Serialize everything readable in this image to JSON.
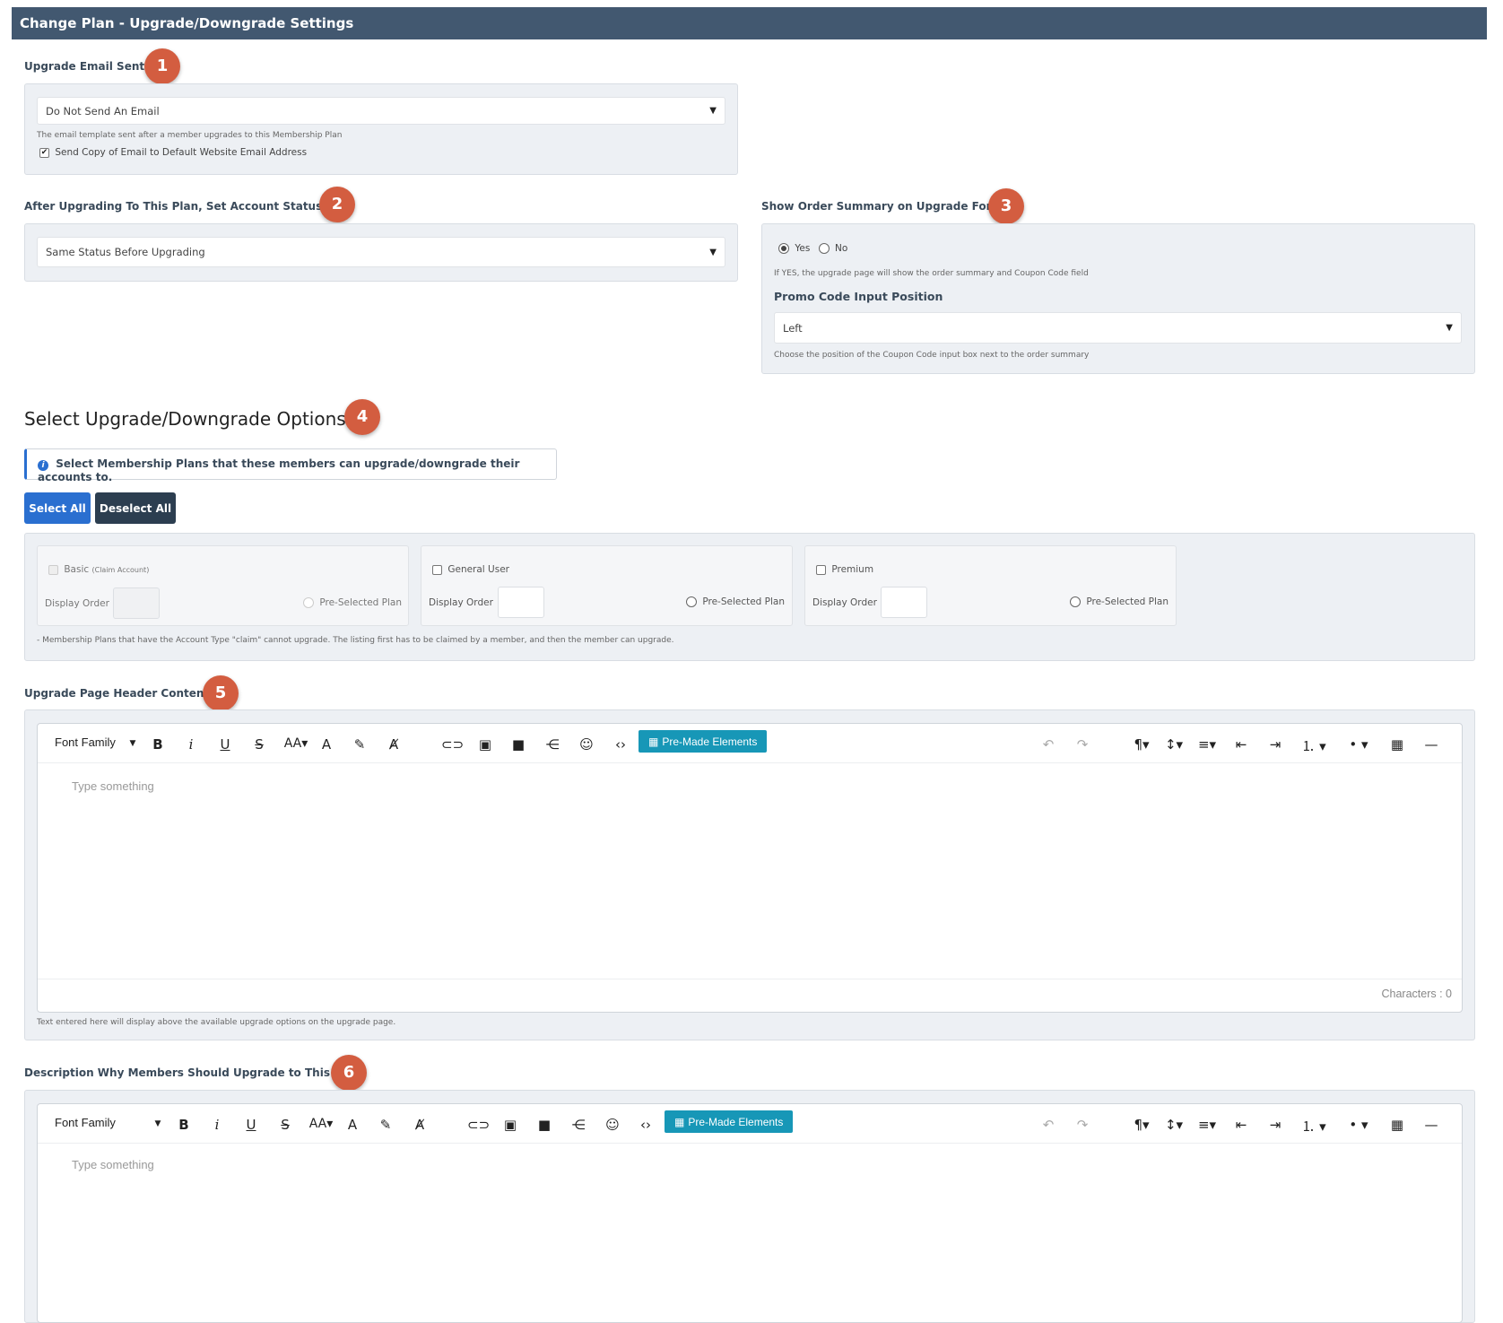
{
  "header": {
    "title": "Change Plan - Upgrade/Downgrade Settings"
  },
  "upgrade_email": {
    "label": "Upgrade Email Sent",
    "badge": "1",
    "selected": "Do Not Send An Email",
    "help": "The email template sent after a member upgrades to this Membership Plan",
    "copy_label": "Send Copy of Email to Default Website Email Address",
    "copy_checked": true
  },
  "account_status": {
    "label": "After Upgrading To This Plan, Set Account Status As:",
    "badge": "2",
    "selected": "Same Status Before Upgrading"
  },
  "order_summary": {
    "label": "Show Order Summary on Upgrade Form",
    "badge": "3",
    "yes": "Yes",
    "no": "No",
    "selected": "Yes",
    "help": "If YES, the upgrade page will show the order summary and Coupon Code field",
    "promo_label": "Promo Code Input Position",
    "promo_selected": "Left",
    "promo_help": "Choose the position of the Coupon Code input box next to the order summary"
  },
  "options": {
    "title": "Select Upgrade/Downgrade Options",
    "badge": "4",
    "info": "Select Membership Plans that these members can upgrade/downgrade their accounts to.",
    "select_all": "Select All",
    "deselect_all": "Deselect All",
    "display_order_label": "Display Order",
    "preselected_label": "Pre-Selected Plan",
    "plans": [
      {
        "name": "Basic",
        "tag": "(Claim Account)",
        "disabled": true
      },
      {
        "name": "General User",
        "tag": "",
        "disabled": false
      },
      {
        "name": "Premium",
        "tag": "",
        "disabled": false
      }
    ],
    "note": "- Membership Plans that have the Account Type \"claim\" cannot upgrade. The listing first has to be claimed by a member, and then the member can upgrade."
  },
  "header_content": {
    "label": "Upgrade Page Header Content",
    "badge": "5",
    "placeholder": "Type something",
    "chars": "Characters : 0",
    "help": "Text entered here will display above the available upgrade options on the upgrade page."
  },
  "description": {
    "label": "Description Why Members Should Upgrade to This Plan",
    "badge": "6",
    "placeholder": "Type something"
  },
  "editor": {
    "font_family": "Font Family",
    "premade": "Pre-Made Elements"
  },
  "colors": {
    "header": "#425870",
    "badge": "#d35d40",
    "primary": "#2a6fd0",
    "dark": "#2c3e50",
    "premade": "#1797b7"
  }
}
